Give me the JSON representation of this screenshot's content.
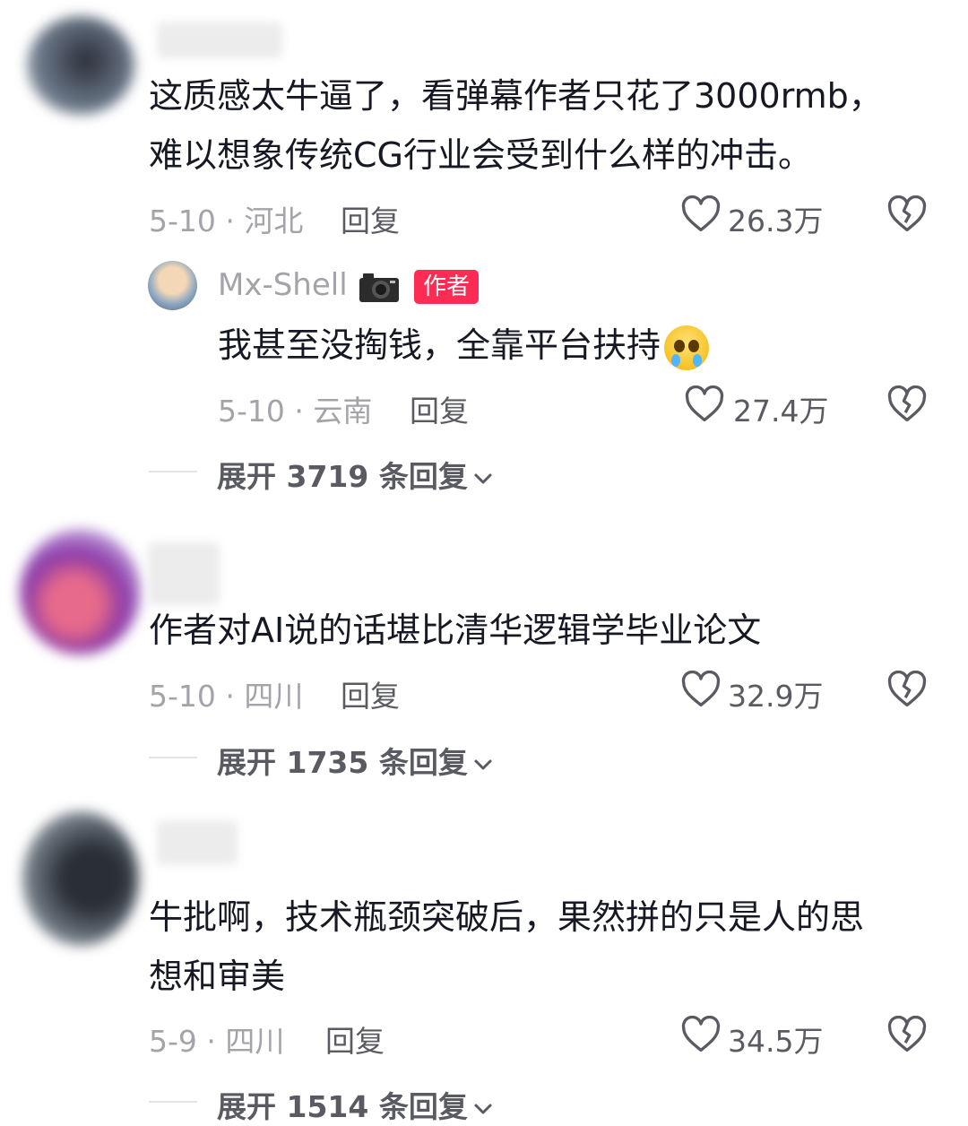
{
  "comments": [
    {
      "text_lines": [
        "这质感太牛逼了，看弹幕作者只花了3000rmb，",
        "难以想象传统CG行业会受到什么样的冲击。"
      ],
      "date_loc": "5-10 · 河北",
      "reply_label": "回复",
      "likes": "26.3万",
      "author_reply": {
        "name": "Mx-Shell",
        "badge_icon": "camera-icon",
        "tag": "作者",
        "text": "我甚至没掏钱，全靠平台扶持",
        "emoji": "crying-face-emoji",
        "date_loc": "5-10 · 云南",
        "reply_label": "回复",
        "likes": "27.4万"
      },
      "expand_label": "展开 3719 条回复"
    },
    {
      "text_lines": [
        "作者对AI说的话堪比清华逻辑学毕业论文"
      ],
      "date_loc": "5-10 · 四川",
      "reply_label": "回复",
      "likes": "32.9万",
      "expand_label": "展开 1735 条回复"
    },
    {
      "text_lines": [
        "牛批啊，技术瓶颈突破后，果然拼的只是人的思",
        "想和审美"
      ],
      "date_loc": "5-9 · 四川",
      "reply_label": "回复",
      "likes": "34.5万",
      "expand_label": "展开 1514 条回复"
    }
  ],
  "icons": {
    "like": "heart-outline-icon",
    "dislike": "broken-heart-icon",
    "expand": "chevron-down-icon"
  },
  "colors": {
    "author_tag": "#fe2c55",
    "text": "#161823",
    "meta": "#a3a4a9"
  }
}
